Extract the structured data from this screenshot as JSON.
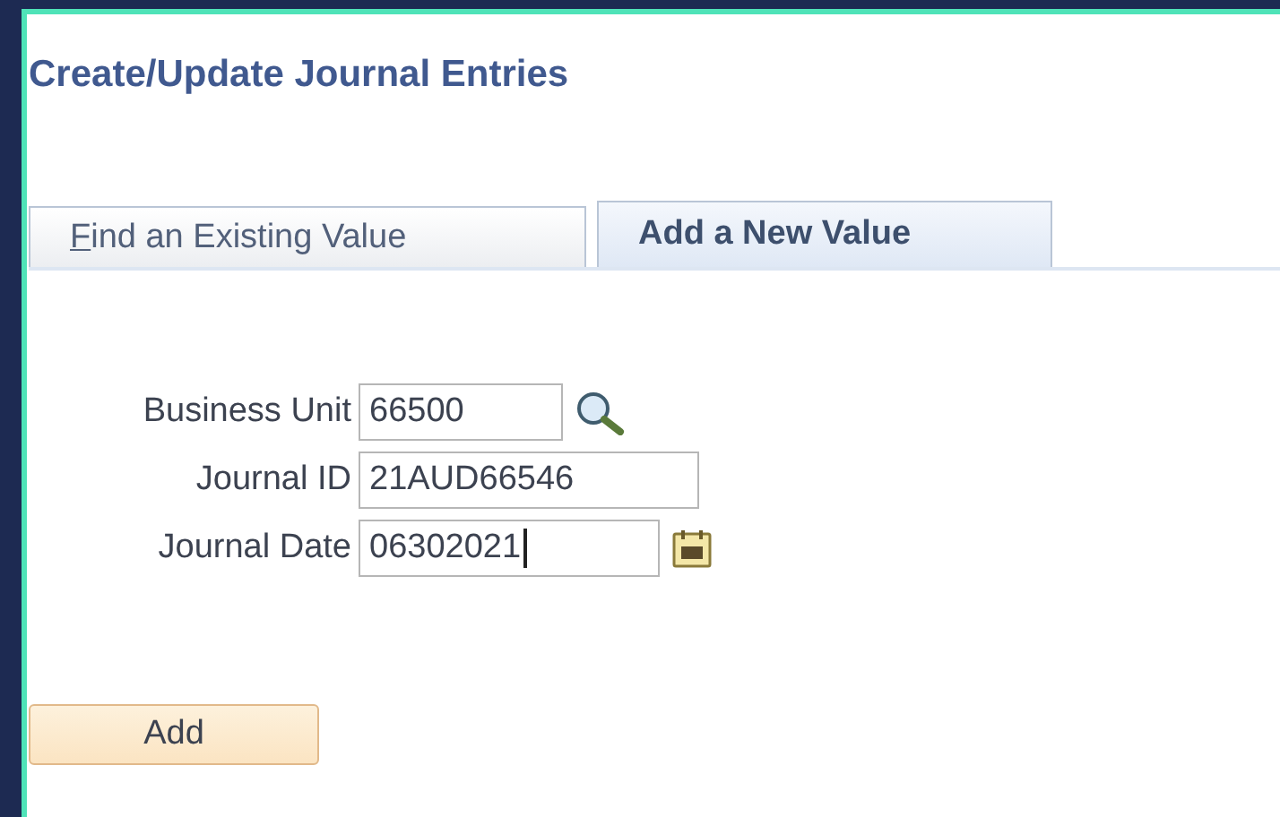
{
  "page": {
    "title": "Create/Update Journal Entries"
  },
  "tabs": [
    {
      "label": "Find an Existing Value",
      "selected": false,
      "underline_first_letter": true
    },
    {
      "label": "Add a New Value",
      "selected": true,
      "underline_first_letter": false
    }
  ],
  "fields": [
    {
      "label": "Business Unit",
      "value": "66500",
      "kind": "lookup",
      "focused": false
    },
    {
      "label": "Journal ID",
      "value": "21AUD66546",
      "kind": "text",
      "focused": false
    },
    {
      "label": "Journal Date",
      "value": "06302021",
      "kind": "date",
      "focused": true
    }
  ],
  "buttons": [
    "Add"
  ]
}
